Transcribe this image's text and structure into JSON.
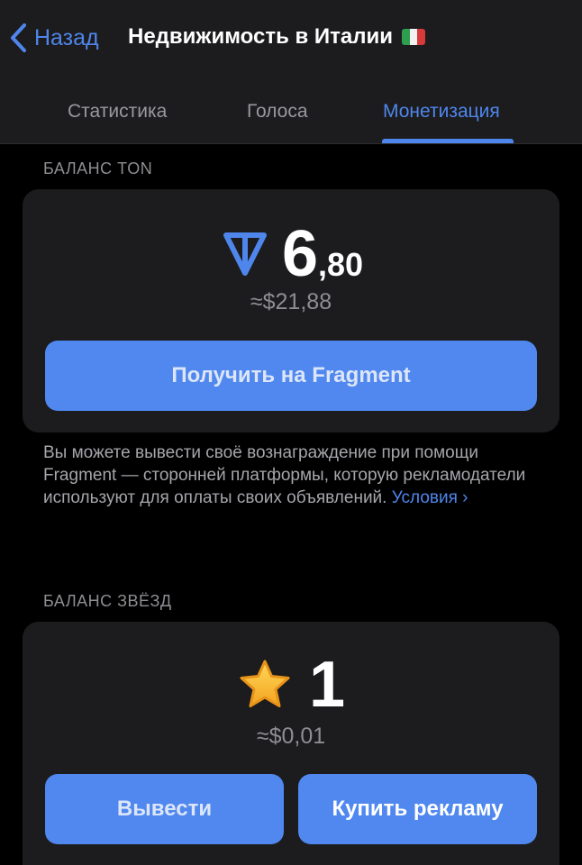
{
  "header": {
    "back_label": "Назад",
    "title": "Недвижимость в Италии",
    "flag_icon": "italy-flag-icon",
    "tabs": [
      {
        "label": "Статистика",
        "active": false
      },
      {
        "label": "Голоса",
        "active": false
      },
      {
        "label": "Монетизация",
        "active": true
      }
    ]
  },
  "ton_balance": {
    "section_title": "БАЛАНС TON",
    "icon": "ton-icon",
    "amount_integer": "6",
    "amount_fraction": ",80",
    "usd_equivalent": "≈$21,88",
    "fragment_button_label": "Получить на Fragment",
    "description": "Вы можете вывести своё вознаграждение при помощи Fragment — сторонней платформы, которую рекламодатели используют для оплаты своих объявлений.",
    "terms_link": "Условия ›"
  },
  "stars_balance": {
    "section_title": "БАЛАНС ЗВЁЗД",
    "icon": "star-icon",
    "amount": "1",
    "usd_equivalent": "≈$0,01",
    "withdraw_button_label": "Вывести",
    "buy_ads_button_label": "Купить рекламу"
  },
  "colors": {
    "accent": "#4f86ec",
    "button": "#5088ef",
    "background": "#000000",
    "card": "#1c1c1e"
  }
}
